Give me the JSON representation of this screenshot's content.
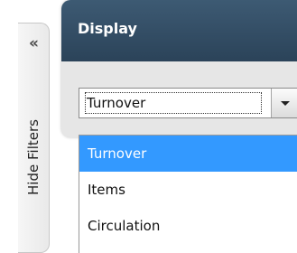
{
  "side_tab": {
    "label": "Hide Filters",
    "collapse_icon": "double-chevron-left-icon",
    "collapse_glyph": "«"
  },
  "panel": {
    "title": "Display"
  },
  "select": {
    "value": "Turnover",
    "arrow_icon": "caret-down-icon"
  },
  "dropdown": {
    "options": [
      "Turnover",
      "Items",
      "Circulation"
    ],
    "selected_index": 0
  },
  "colors": {
    "header_bg": "#34506a",
    "highlight": "#3399ff",
    "panel_bg": "#e6e6e6"
  }
}
